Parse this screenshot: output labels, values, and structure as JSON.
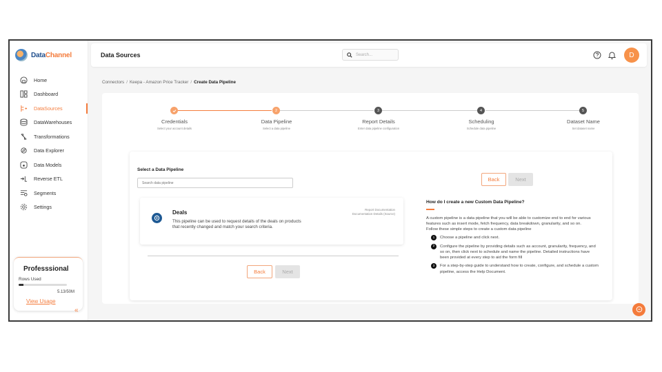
{
  "app": {
    "logo_text_primary": "Data",
    "logo_text_accent": "Channel"
  },
  "colors": {
    "accent": "#f47b3b",
    "brand_blue": "#1f4e8c",
    "muted": "#aaaaaa"
  },
  "sidebar": {
    "items": [
      {
        "label": "Home",
        "icon": "home-icon",
        "active": false
      },
      {
        "label": "Dashboard",
        "icon": "dashboard-icon",
        "active": false
      },
      {
        "label": "DataSources",
        "icon": "datasources-icon",
        "active": true
      },
      {
        "label": "DataWarehouses",
        "icon": "database-icon",
        "active": false
      },
      {
        "label": "Transformations",
        "icon": "transform-icon",
        "active": false
      },
      {
        "label": "Data Explorer",
        "icon": "explorer-icon",
        "active": false
      },
      {
        "label": "Data Models",
        "icon": "models-icon",
        "active": false
      },
      {
        "label": "Reverse ETL",
        "icon": "reverse-etl-icon",
        "active": false
      },
      {
        "label": "Segments",
        "icon": "segments-icon",
        "active": false
      },
      {
        "label": "Settings",
        "icon": "settings-icon",
        "active": false
      }
    ],
    "plan": {
      "title": "Professsional",
      "rows_label": "Rows Used",
      "usage_fraction": 0.1,
      "count": "5.13/50M",
      "link": "View Usage"
    },
    "collapse_glyph": "«"
  },
  "header": {
    "title": "Data Sources",
    "search_placeholder": "Search...",
    "avatar_initial": "D"
  },
  "breadcrumb": {
    "items": [
      "Connectors",
      "Keepa - Amazon Price Tracker"
    ],
    "current": "Create Data Pipeline",
    "separator": "/"
  },
  "stepper": {
    "steps": [
      {
        "number": "1",
        "title": "Credentials",
        "subtitle": "Select your account details",
        "state": "done"
      },
      {
        "number": "2",
        "title": "Data Pipeline",
        "subtitle": "Select a data pipeline",
        "state": "current"
      },
      {
        "number": "3",
        "title": "Report Details",
        "subtitle": "Enter data pipeline configuration",
        "state": "pending"
      },
      {
        "number": "4",
        "title": "Scheduling",
        "subtitle": "Schedule data pipeline",
        "state": "pending"
      },
      {
        "number": "5",
        "title": "Dataset Name",
        "subtitle": "Set dataset name",
        "state": "pending"
      }
    ]
  },
  "form": {
    "label": "Select a Data Pipeline",
    "search_placeholder": "Search data pipeline",
    "back_label": "Back",
    "next_label": "Next"
  },
  "pipelines": [
    {
      "title": "Deals",
      "description": "This pipeline can be used to request details of the deals on products that recently changed and match your search criteria.",
      "link_report": "Report Documentation",
      "link_details": "Documentation Details (Source)"
    }
  ],
  "help": {
    "title": "How do I create a new Custom Data Pipeline?",
    "intro": "A custom pipeline is a data pipeline that you will be able to customize end to end for various features such as insert mode, fetch frequency, data breakdown, granularity, and so on.",
    "intro2": "Follow these simple steps to create a custom data pipeline",
    "steps": [
      "Choose a pipeline and click next.",
      "Configure the pipeline by providing details such as account, granularity, frequency, and so on, then click next to schedule and name the pipeline. Detailed instructions have been provided at every step to aid the form fill",
      "For a step-by-step guide to understand how to create, configure, and schedule a custom pipeline, access the Help Document."
    ]
  }
}
